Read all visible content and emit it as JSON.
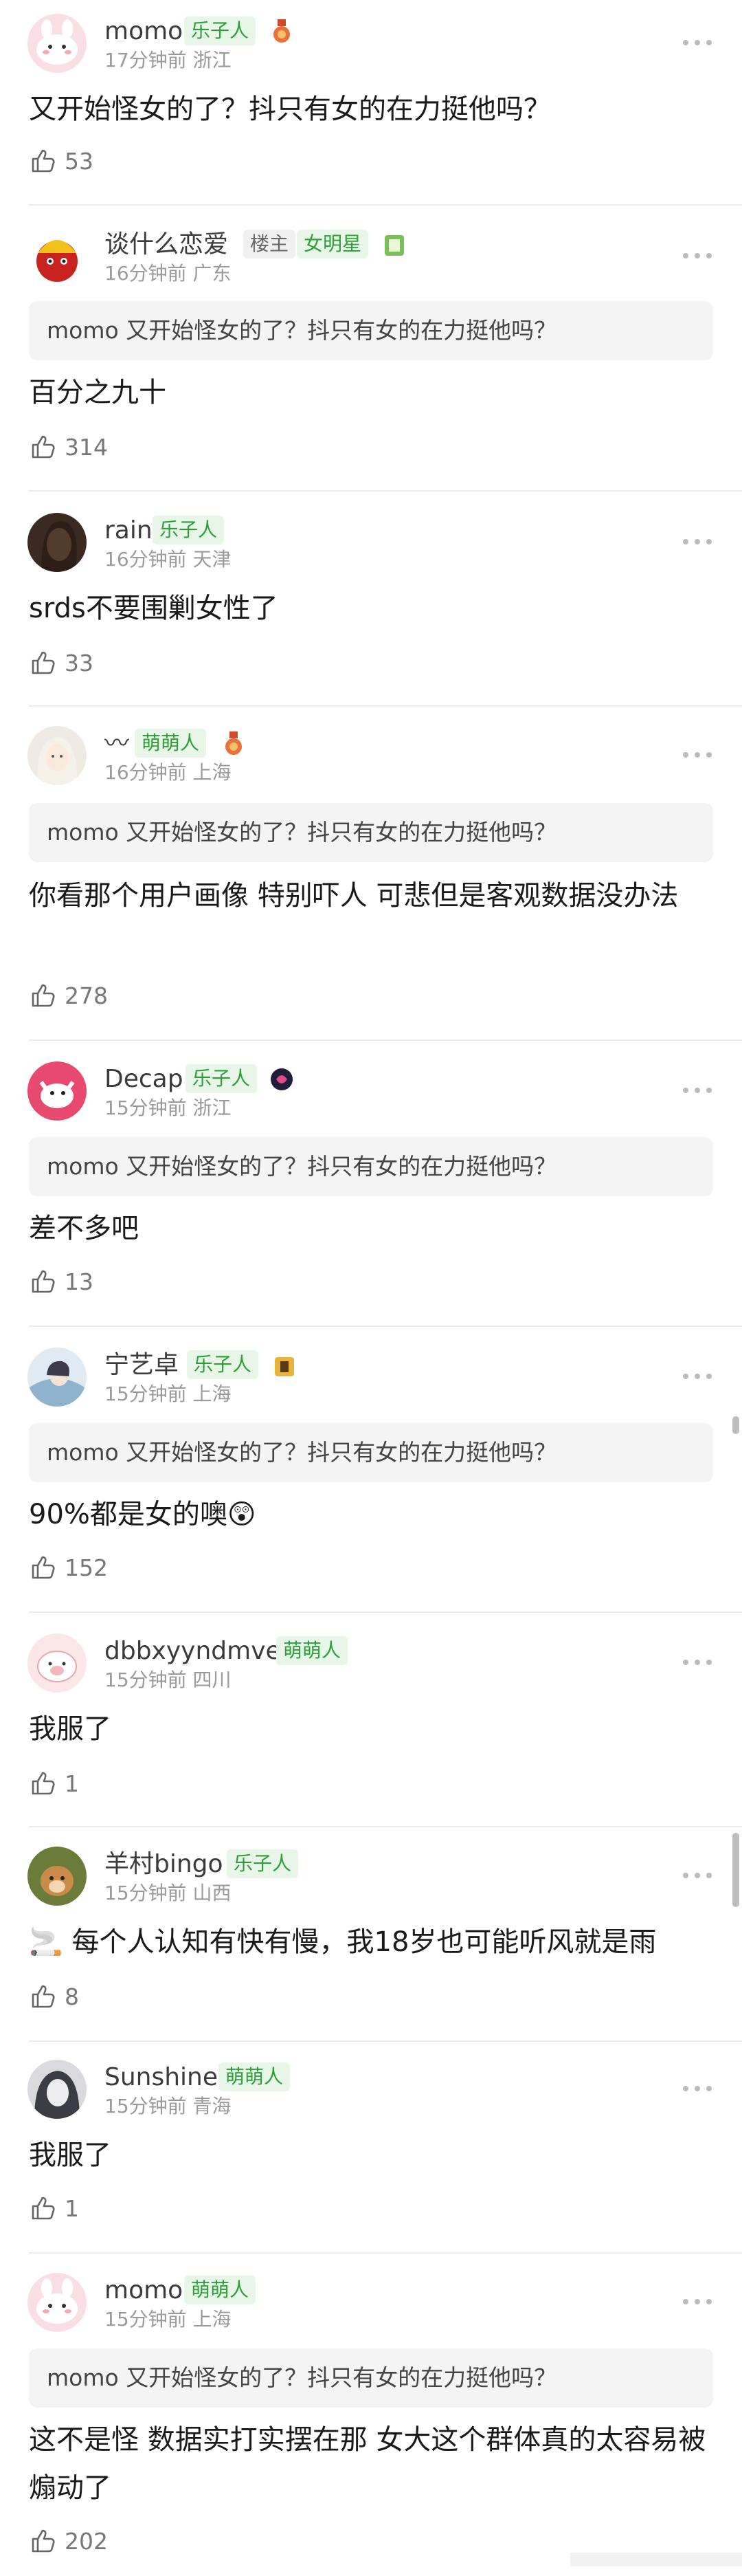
{
  "comments": [
    {
      "name": "momo",
      "badges": [
        "乐子人"
      ],
      "time": "17分钟前",
      "location": "浙江",
      "quote": "",
      "text": "又开始怪女的了？抖只有女的在力挺他吗？",
      "likes": "53"
    },
    {
      "name": "谈什么恋爱",
      "badges": [
        "楼主",
        "女明星"
      ],
      "time": "16分钟前",
      "location": "广东",
      "quote": "momo 又开始怪女的了？抖只有女的在力挺他吗？",
      "text": "百分之九十",
      "likes": "314"
    },
    {
      "name": "rain",
      "badges": [
        "乐子人"
      ],
      "time": "16分钟前",
      "location": "天津",
      "quote": "",
      "text": "srds不要围剿女性了",
      "likes": "33"
    },
    {
      "name": "〰",
      "badges": [
        "萌萌人"
      ],
      "time": "16分钟前",
      "location": "上海",
      "quote": "momo 又开始怪女的了？抖只有女的在力挺他吗？",
      "text": "你看那个用户画像 特别吓人 可悲但是客观数据没办法",
      "likes": "278"
    },
    {
      "name": "Decap",
      "badges": [
        "乐子人"
      ],
      "time": "15分钟前",
      "location": "浙江",
      "quote": "momo 又开始怪女的了？抖只有女的在力挺他吗？",
      "text": "差不多吧",
      "likes": "13"
    },
    {
      "name": "宁艺卓",
      "badges": [
        "乐子人"
      ],
      "time": "15分钟前",
      "location": "上海",
      "quote": "momo 又开始怪女的了？抖只有女的在力挺他吗？",
      "text": "90%都是女的噢😲",
      "likes": "152"
    },
    {
      "name": "dbbxyyndmve",
      "badges": [
        "萌萌人"
      ],
      "time": "15分钟前",
      "location": "四川",
      "quote": "",
      "text": "我服了",
      "likes": "1"
    },
    {
      "name": "羊村bingo",
      "badges": [
        "乐子人"
      ],
      "time": "15分钟前",
      "location": "山西",
      "quote": "",
      "text": "🚬 每个人认知有快有慢，我18岁也可能听风就是雨",
      "likes": "8"
    },
    {
      "name": "Sunshine",
      "badges": [
        "萌萌人"
      ],
      "time": "15分钟前",
      "location": "青海",
      "quote": "",
      "text": "我服了",
      "likes": "1"
    },
    {
      "name": "momo",
      "badges": [
        "萌萌人"
      ],
      "time": "15分钟前",
      "location": "上海",
      "quote": "momo 又开始怪女的了？抖只有女的在力挺他吗？",
      "text": "这不是怪 数据实打实摆在那 女大这个群体真的太容易被煽动了",
      "likes": "202"
    }
  ],
  "colors": {
    "badge_green": "#2f9e3a",
    "badge_bg": "#e8f6e8",
    "meta_gray": "#9a9a9a",
    "quote_bg": "#f4f4f4"
  }
}
